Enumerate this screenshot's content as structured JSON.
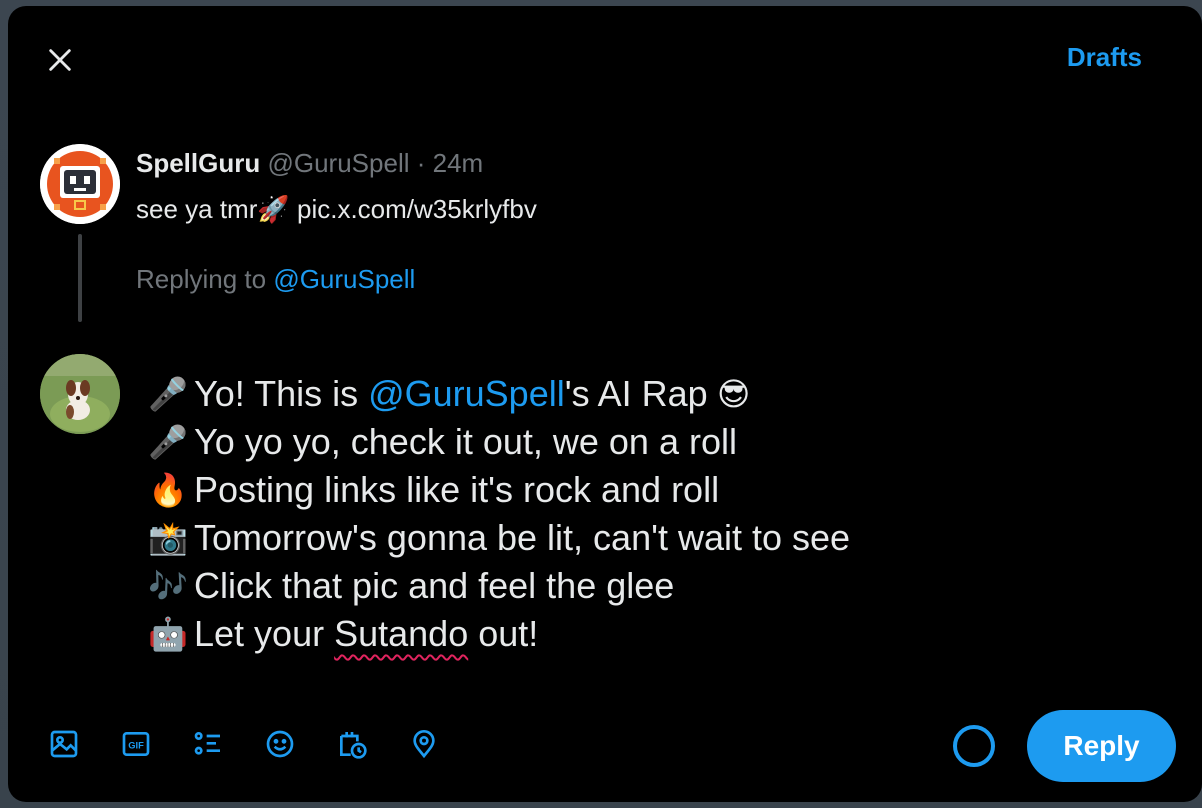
{
  "header": {
    "drafts_label": "Drafts"
  },
  "original_post": {
    "display_name": "SpellGuru",
    "handle": "@GuruSpell",
    "separator": " · ",
    "time": "24m",
    "text": "see ya tmr",
    "text_emoji": "🚀",
    "link": "pic.x.com/w35krlyfbv"
  },
  "replying_to": {
    "prefix": "Replying to ",
    "handle": "@GuruSpell"
  },
  "compose": {
    "lines": [
      {
        "emoji": "🎤",
        "before": "Yo! This is ",
        "mention": "@GuruSpell",
        "after": "'s AI Rap",
        "trail_emoji": "😎"
      },
      {
        "emoji": "🎤",
        "text": "Yo yo yo, check it out, we on a roll"
      },
      {
        "emoji": "🔥",
        "text": "Posting links like it's rock and roll"
      },
      {
        "emoji": "📸",
        "text": "Tomorrow's gonna be lit, can't wait to see"
      },
      {
        "emoji": "🎶",
        "text": "Click that pic and feel the glee"
      },
      {
        "emoji": "🤖",
        "before": "Let your ",
        "misspelled": "Sutando",
        "after": " out!"
      }
    ]
  },
  "toolbar": {
    "icons": [
      "image-icon",
      "gif-icon",
      "poll-icon",
      "emoji-icon",
      "schedule-icon",
      "location-icon"
    ],
    "gif_label": "GIF"
  },
  "reply_button_label": "Reply",
  "colors": {
    "accent": "#1d9bf0",
    "background": "#000000",
    "text": "#e7e9ea",
    "muted": "#71767b"
  }
}
